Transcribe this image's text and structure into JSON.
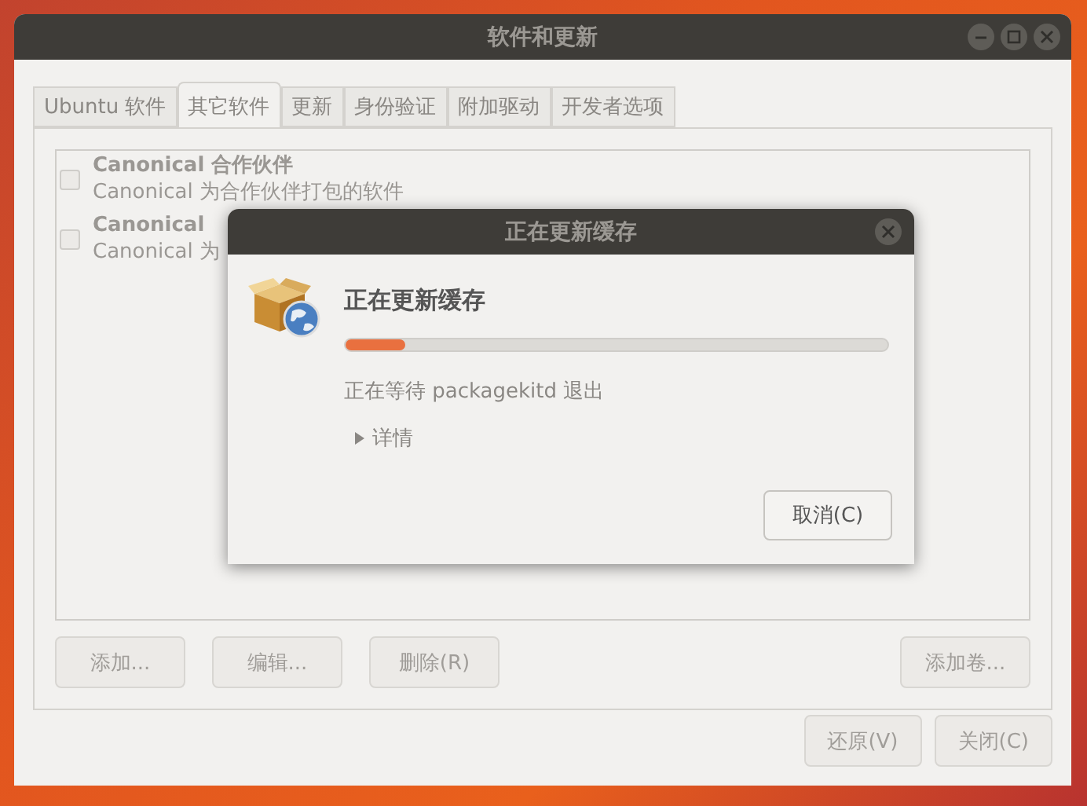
{
  "window": {
    "title": "软件和更新"
  },
  "tabs": [
    {
      "label": "Ubuntu 软件",
      "selected": false
    },
    {
      "label": "其它软件",
      "selected": true
    },
    {
      "label": "更新",
      "selected": false
    },
    {
      "label": "身份验证",
      "selected": false
    },
    {
      "label": "附加驱动",
      "selected": false
    },
    {
      "label": "开发者选项",
      "selected": false
    }
  ],
  "sources": [
    {
      "title": "Canonical 合作伙伴",
      "description": "Canonical 为合作伙伴打包的软件",
      "checked": false
    },
    {
      "title": "Canonical",
      "description": "Canonical 为",
      "checked": false
    }
  ],
  "list_buttons": [
    "添加...",
    "编辑...",
    "删除(R)"
  ],
  "add_volume_button": "添加卷...",
  "footer_buttons": [
    "还原(V)",
    "关闭(C)"
  ],
  "dialog": {
    "title": "正在更新缓存",
    "heading": "正在更新缓存",
    "progress": {
      "level": 0.11
    },
    "message": "正在等待 packagekitd 退出",
    "details": {
      "label": "详情",
      "expanded": false
    },
    "cancel": "取消(C)"
  }
}
